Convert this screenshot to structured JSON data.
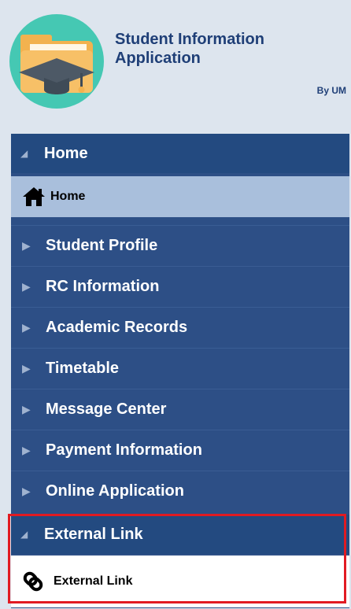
{
  "header": {
    "title": "Student Information Application",
    "by_line": "By UM"
  },
  "menu": {
    "home_section": "Home",
    "home_item": "Home",
    "items": [
      "Student Profile",
      "RC Information",
      "Academic Records",
      "Timetable",
      "Message Center",
      "Payment Information",
      "Online Application"
    ],
    "external_section": "External Link",
    "external_item": "External Link"
  },
  "icons": {
    "logo": "folder-graduation-cap-icon",
    "home": "home-icon",
    "external": "chain-link-icon",
    "collapsed_arrow": "triangle-right-icon",
    "expanded_arrow": "triangle-down-left-icon"
  },
  "colors": {
    "header_bg": "#dde5ee",
    "menu_bg": "#2d4f86",
    "section_bg": "#234a80",
    "selected_bg": "#a9bfdc",
    "highlight": "#e11b22",
    "title_text": "#1f3f77"
  }
}
